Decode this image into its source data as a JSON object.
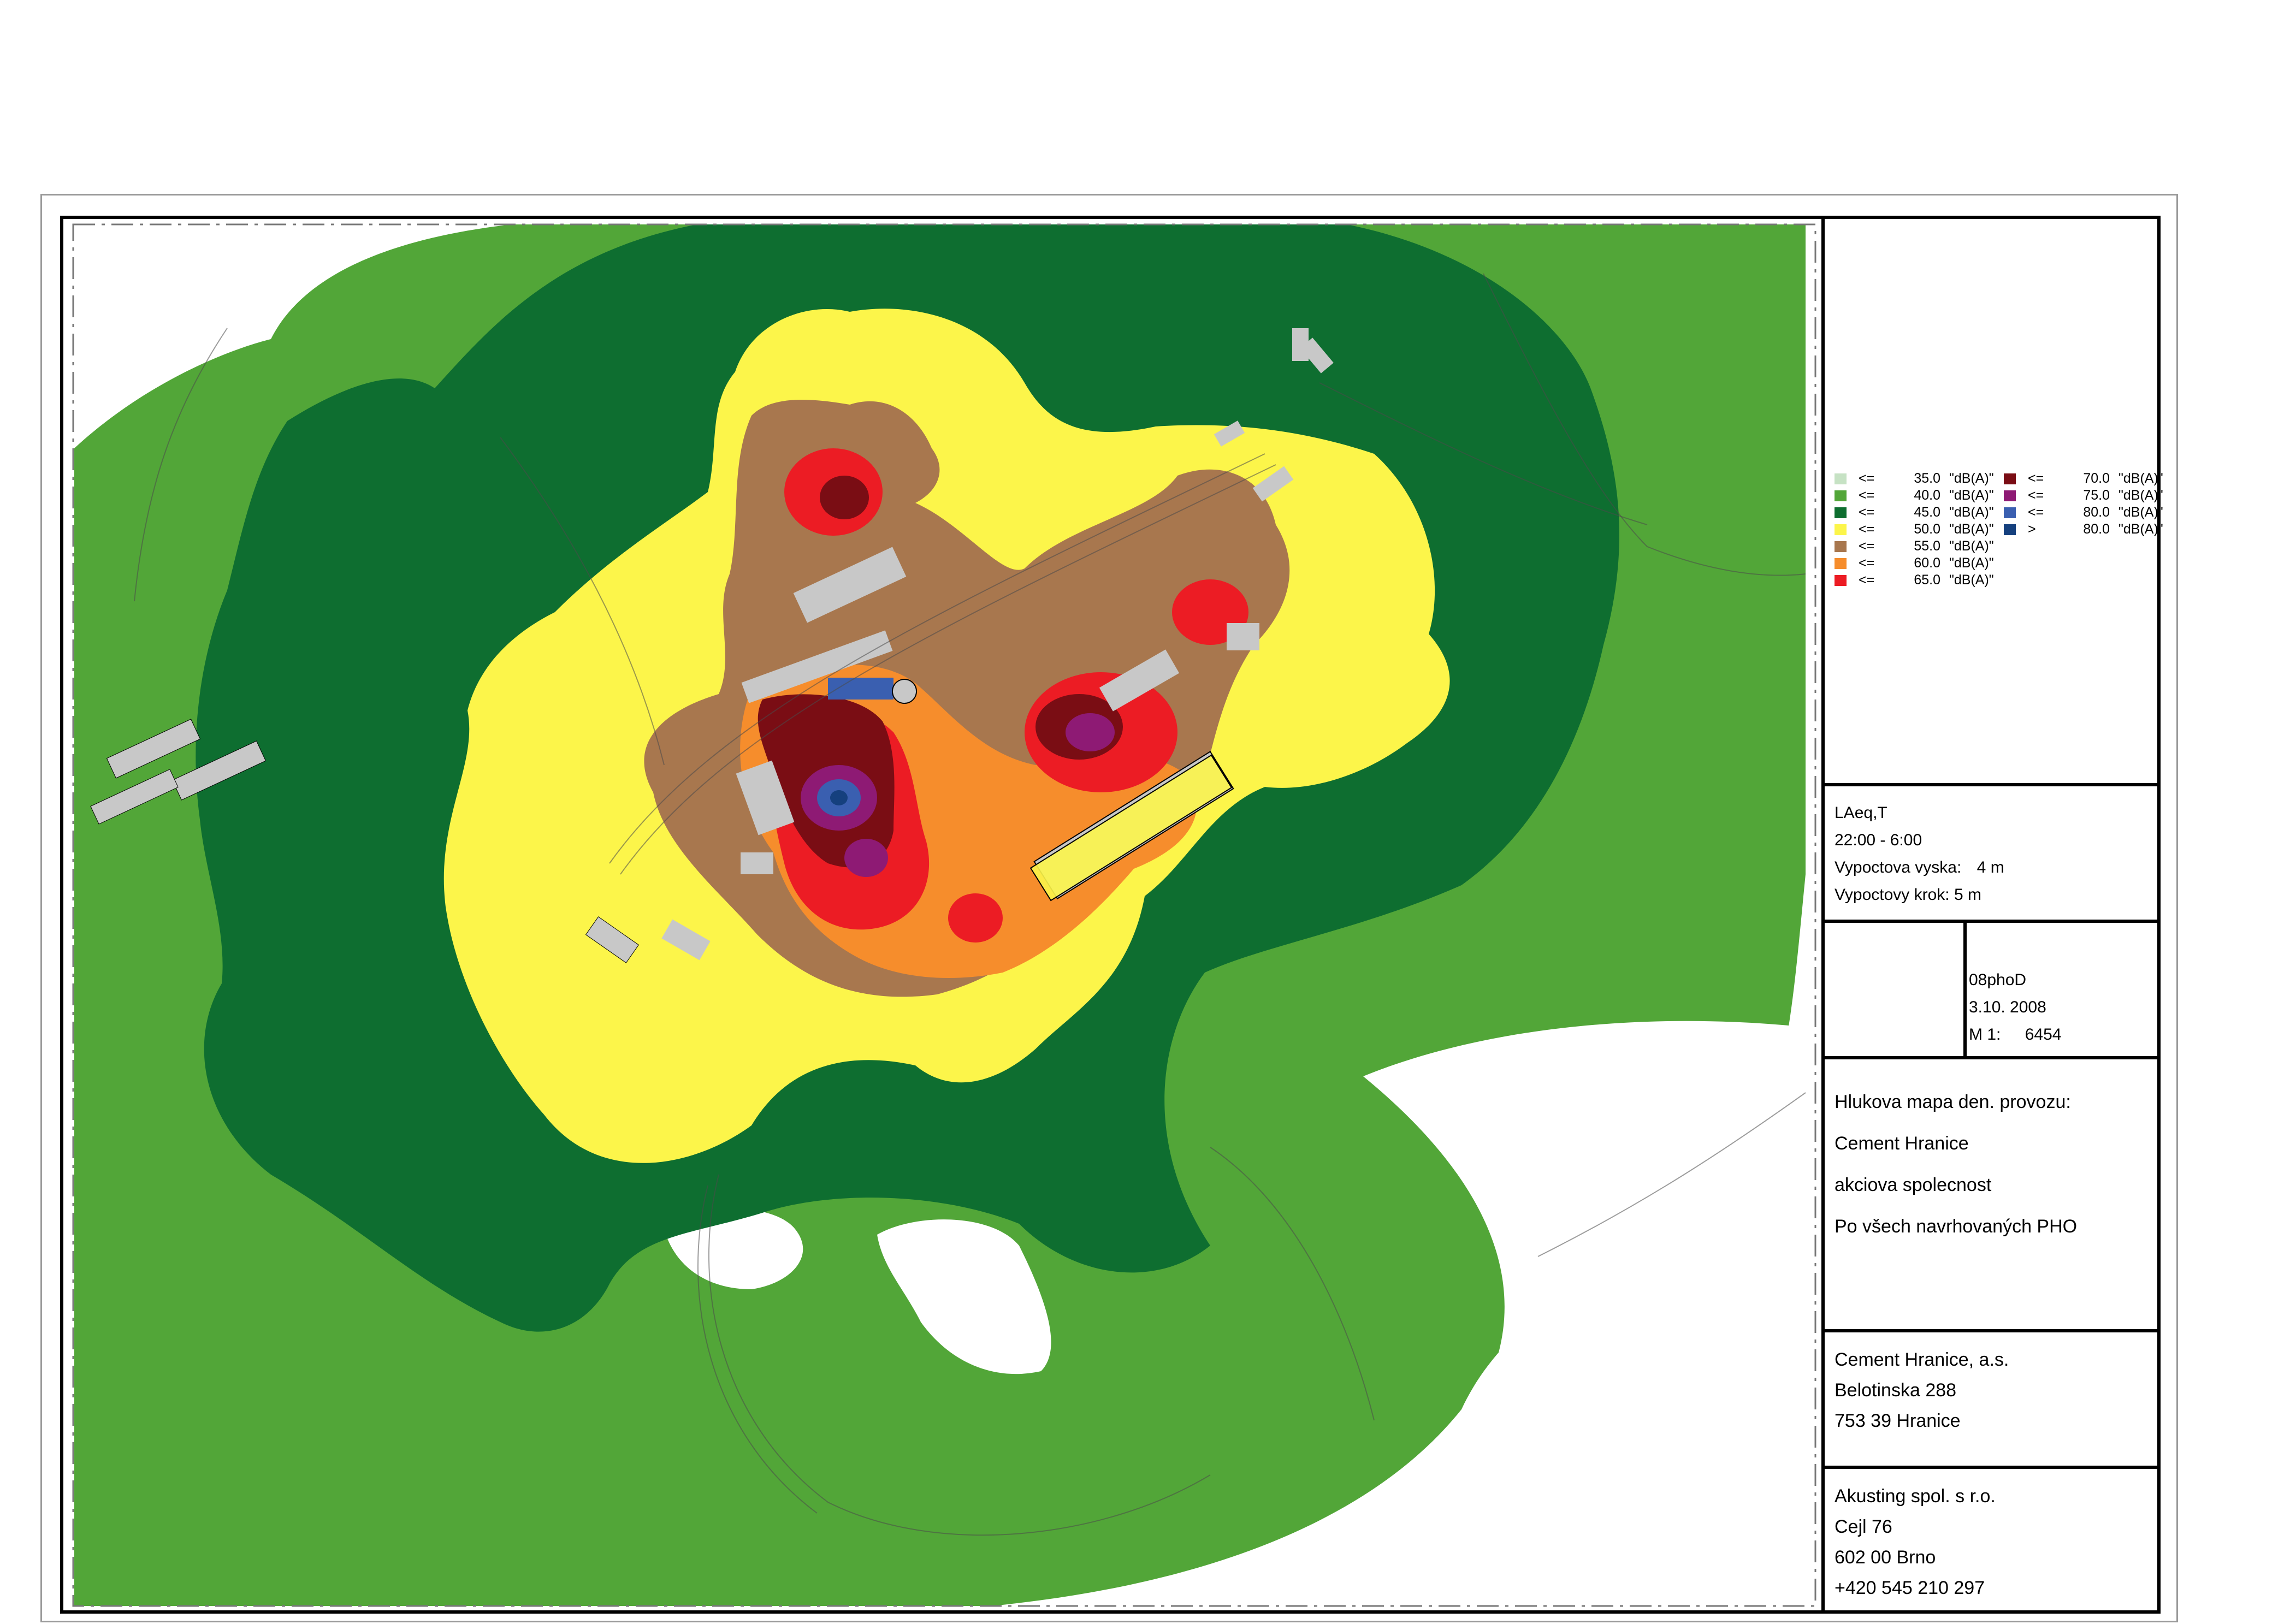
{
  "legend": {
    "unit": "\"dB(A)\"",
    "items": [
      {
        "op": "<=",
        "value": "35.0",
        "color": "#c6e2c4"
      },
      {
        "op": "<=",
        "value": "40.0",
        "color": "#52a638"
      },
      {
        "op": "<=",
        "value": "45.0",
        "color": "#0e6e30"
      },
      {
        "op": "<=",
        "value": "50.0",
        "color": "#fcf54a"
      },
      {
        "op": "<=",
        "value": "55.0",
        "color": "#a8774e"
      },
      {
        "op": "<=",
        "value": "60.0",
        "color": "#f68d2c"
      },
      {
        "op": "<=",
        "value": "65.0",
        "color": "#ec1c24"
      },
      {
        "op": "<=",
        "value": "70.0",
        "color": "#7a0d14"
      },
      {
        "op": "<=",
        "value": "75.0",
        "color": "#8e1a74"
      },
      {
        "op": "<=",
        "value": "80.0",
        "color": "#3a5fb0"
      },
      {
        "op": ">",
        "value": "80.0",
        "color": "#15407e"
      }
    ]
  },
  "calc": {
    "metric": "LAeq,T",
    "period": "22:00 - 6:00",
    "height_label": "Vypoctova vyska:",
    "height_value": "4 m",
    "step_label": "Vypoctovy krok: 5 m"
  },
  "drawing": {
    "code": "08phoD",
    "date": "3.10. 2008",
    "scale_label": "M 1:",
    "scale_value": "6454"
  },
  "title": {
    "line1": "Hlukova mapa den. provozu:",
    "line2": "Cement Hranice",
    "line3": "akciova spolecnost",
    "line4": "Po všech navrhovaných PHO"
  },
  "client": {
    "name": "Cement Hranice, a.s.",
    "street": "Belotinska 288",
    "city": "753 39 Hranice"
  },
  "author": {
    "name": "Akusting spol. s r.o.",
    "street": "Cejl 76",
    "city": "602 00  Brno",
    "phone": "+420 545 210 297"
  },
  "map": {
    "bands": {
      "b40": "#52a638",
      "b45": "#0e6e30",
      "b50": "#fcf54a",
      "b55": "#a8774e",
      "b60": "#f68d2c",
      "b65": "#ec1c24",
      "b70": "#7a0d14",
      "b75": "#8e1a74",
      "b80": "#3a5fb0",
      "b80plus": "#15407e",
      "building": "#c8c8c8"
    }
  }
}
